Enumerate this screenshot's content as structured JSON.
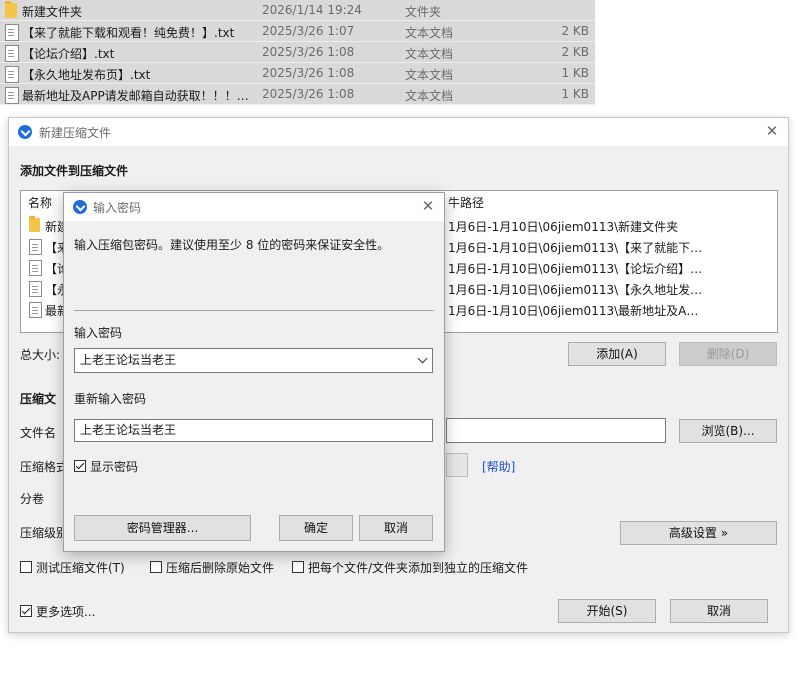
{
  "background_list": [
    {
      "icon": "folder-icon",
      "name": "新建文件夹",
      "date": "2026/1/14 19:24",
      "type": "文件夹",
      "size": ""
    },
    {
      "icon": "text-file-icon",
      "name": "【来了就能下载和观看！纯免费！】.txt",
      "date": "2025/3/26 1:07",
      "type": "文本文档",
      "size": "2 KB"
    },
    {
      "icon": "text-file-icon",
      "name": "【论坛介绍】.txt",
      "date": "2025/3/26 1:08",
      "type": "文本文档",
      "size": "2 KB"
    },
    {
      "icon": "text-file-icon",
      "name": "【永久地址发布页】.txt",
      "date": "2025/3/26 1:08",
      "type": "文本文档",
      "size": "1 KB"
    },
    {
      "icon": "text-file-icon",
      "name": "最新地址及APP请发邮箱自动获取！！！....",
      "date": "2025/3/26 1:08",
      "type": "文本文档",
      "size": "1 KB"
    }
  ],
  "main_dialog": {
    "title": "新建压缩文件",
    "section_add": "添加文件到压缩文件",
    "columns": {
      "name": "名称",
      "path_tail": "牛路径"
    },
    "file_rows": [
      {
        "icon": "folder-icon",
        "name": "新建",
        "path": "1月6日-1月10日\\06jiem0113\\新建文件夹"
      },
      {
        "icon": "text-file-icon",
        "name": "【来",
        "path": "1月6日-1月10日\\06jiem0113\\【来了就能下载..."
      },
      {
        "icon": "text-file-icon",
        "name": "【论",
        "path": "1月6日-1月10日\\06jiem0113\\【论坛介绍】.txt"
      },
      {
        "icon": "text-file-icon",
        "name": "【永",
        "path": "1月6日-1月10日\\06jiem0113\\【永久地址发布..."
      },
      {
        "icon": "text-file-icon",
        "name": "最新",
        "path": "1月6日-1月10日\\06jiem0113\\最新地址及APP..."
      }
    ],
    "total_size_label": "总大小:",
    "add_button": "添加(A)",
    "delete_button": "删除(D)",
    "section_compress": "压缩文",
    "filename_label": "文件名",
    "browse_button": "浏览(B)...",
    "format_label": "压缩格式",
    "help_link": "[帮助]",
    "split_label": "分卷",
    "level_label": "压缩级别",
    "advanced_button": "高级设置 »",
    "opt_test": "测试压缩文件(T)",
    "opt_delete_original": "压缩后删除原始文件",
    "opt_each_separate": "把每个文件/文件夹添加到独立的压缩文件",
    "more_options": "更多选项...",
    "start_button": "开始(S)",
    "cancel_button": "取消"
  },
  "password_dialog": {
    "title": "输入密码",
    "hint": "输入压缩包密码。建议使用至少 8 位的密码来保证安全性。",
    "password_label": "输入密码",
    "password_value": "上老王论坛当老王",
    "repeat_label": "重新输入密码",
    "repeat_value": "上老王论坛当老王",
    "show_password": "显示密码",
    "show_password_checked": true,
    "manager_button": "密码管理器...",
    "ok_button": "确定",
    "cancel_button": "取消"
  },
  "colors": {
    "accent": "#1f6fd6",
    "dialog_bg": "#f0f0f0",
    "link": "#1a4fd8"
  }
}
